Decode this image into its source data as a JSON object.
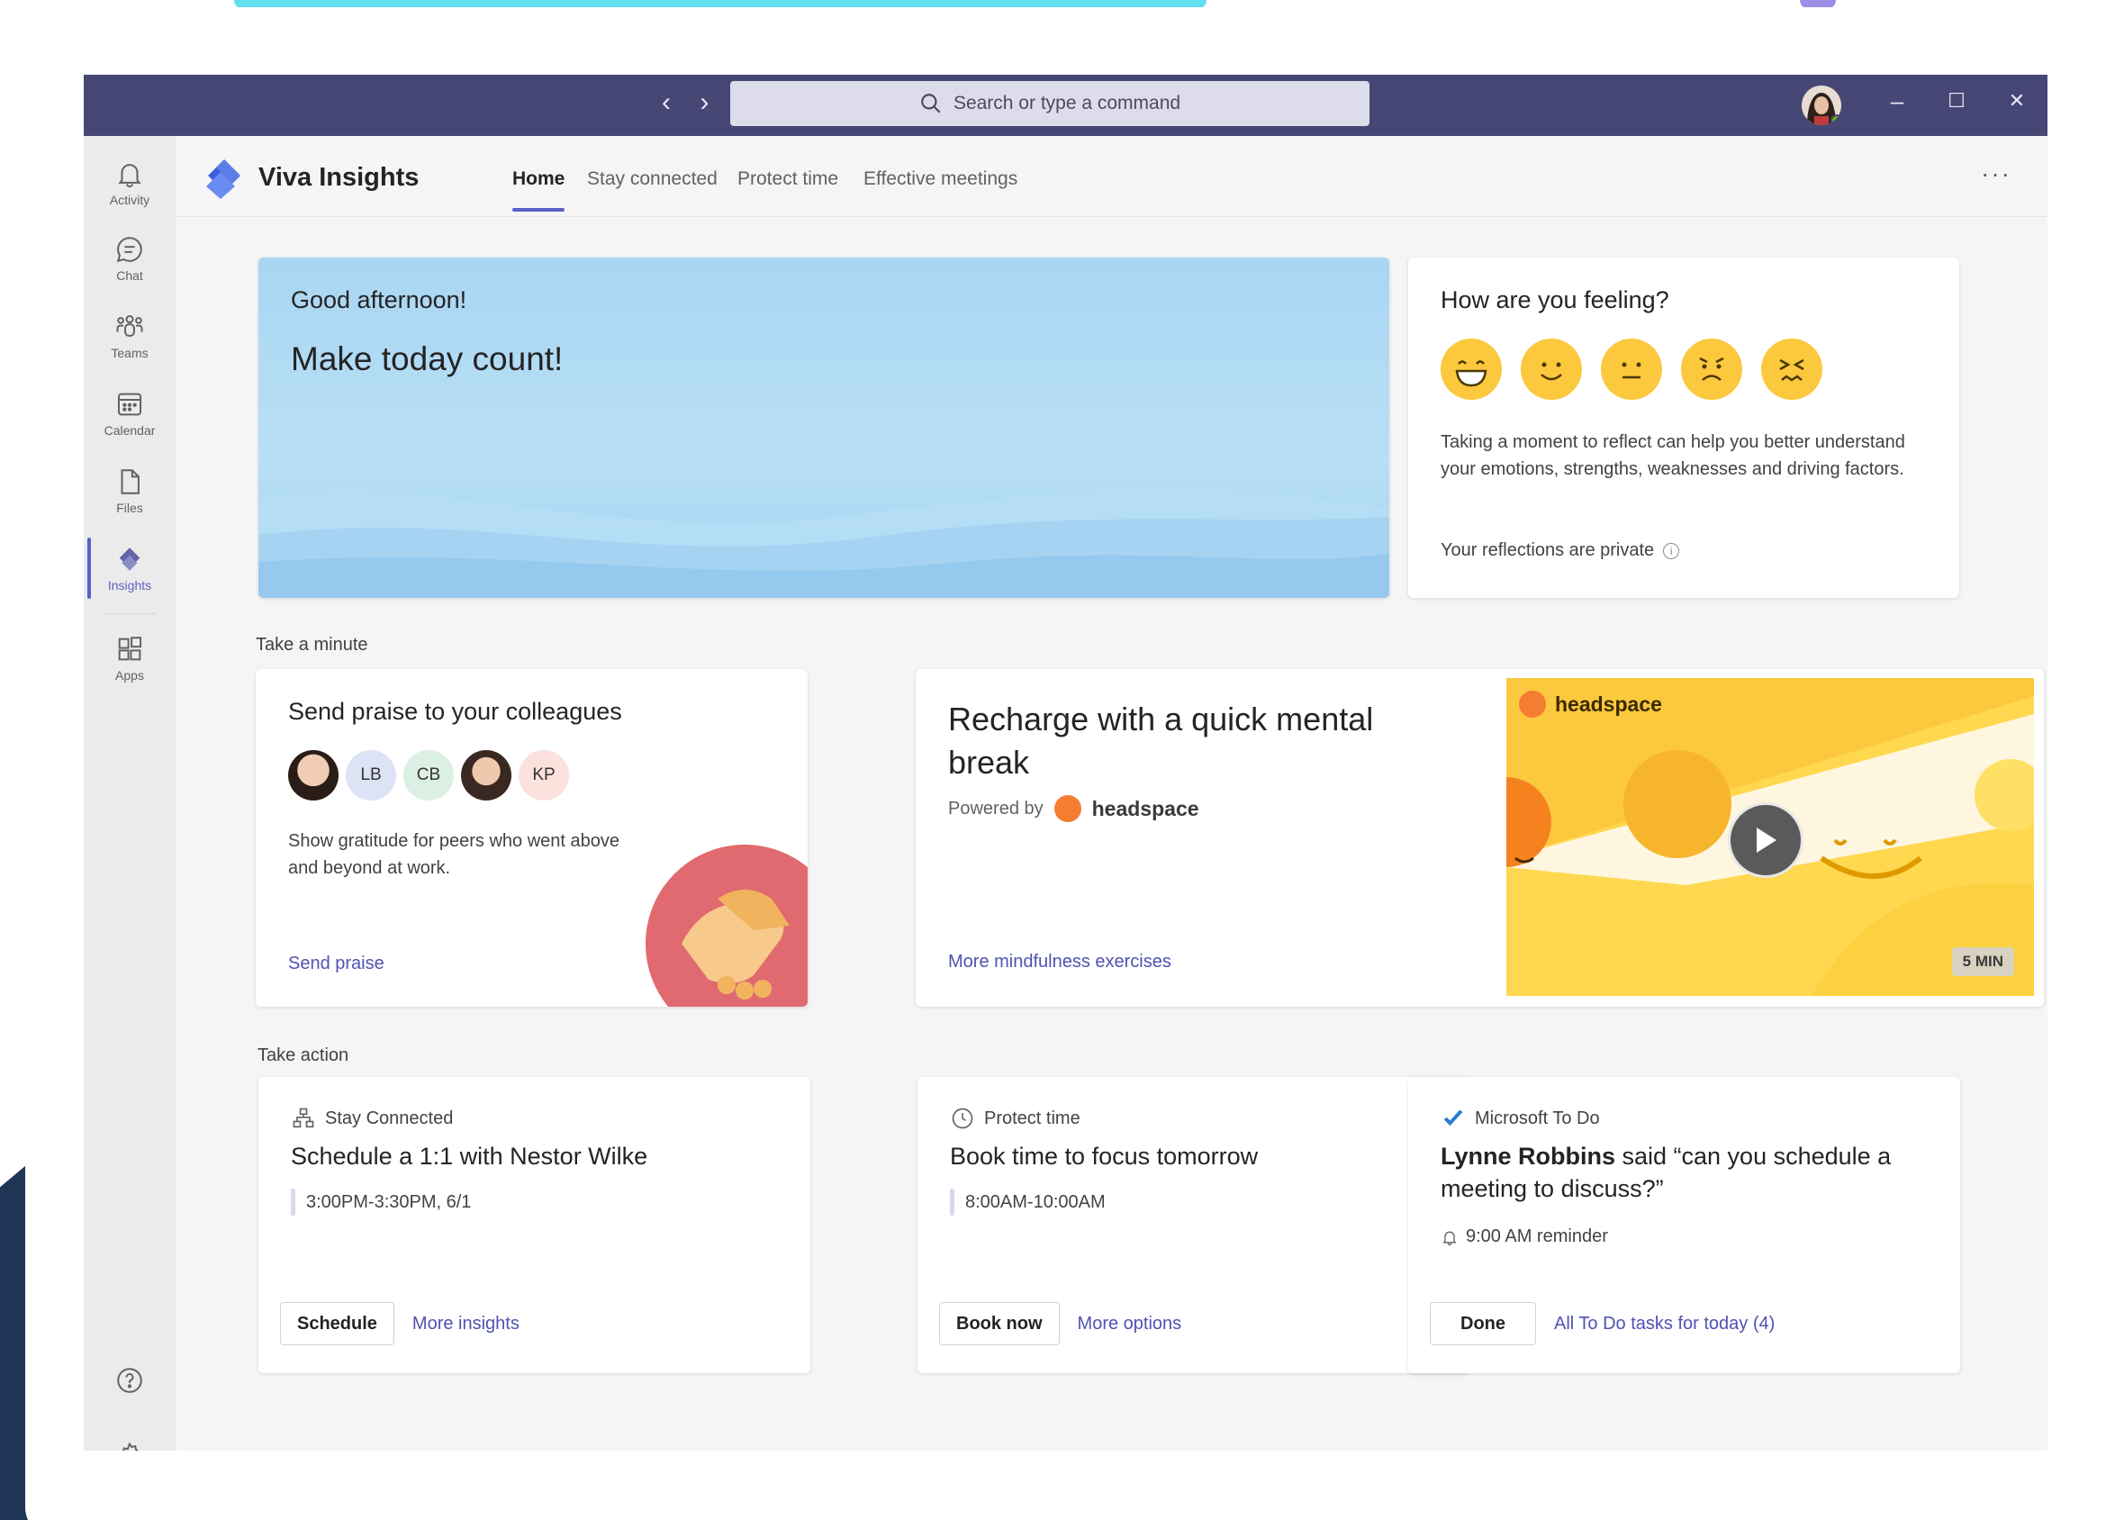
{
  "window": {
    "search_placeholder": "Search or type a command",
    "nav_arrows": "‹ ›",
    "controls": {
      "minimize": "–",
      "maximize": "☐",
      "close": "✕"
    }
  },
  "rail": {
    "items": [
      {
        "label": "Activity",
        "icon": "bell-icon"
      },
      {
        "label": "Chat",
        "icon": "chat-icon"
      },
      {
        "label": "Teams",
        "icon": "teams-icon"
      },
      {
        "label": "Calendar",
        "icon": "calendar-icon"
      },
      {
        "label": "Files",
        "icon": "file-icon"
      },
      {
        "label": "Insights",
        "icon": "insights-icon",
        "active": true
      },
      {
        "label": "Apps",
        "icon": "apps-icon"
      }
    ]
  },
  "app": {
    "title": "Viva Insights",
    "tabs": [
      "Home",
      "Stay connected",
      "Protect time",
      "Effective meetings"
    ],
    "active_tab": "Home",
    "more": "···"
  },
  "hero": {
    "greeting": "Good afternoon!",
    "tagline": "Make today count!"
  },
  "feeling": {
    "title": "How are you feeling?",
    "emojis": [
      "very-happy-emoji-icon",
      "happy-emoji-icon",
      "neutral-emoji-icon",
      "sad-emoji-icon",
      "upset-emoji-icon"
    ],
    "body": "Taking a moment to reflect can help you better understand your emotions, strengths, weaknesses and driving factors.",
    "private_note": "Your reflections are private",
    "info_glyph": "i"
  },
  "sections": {
    "take_a_minute": "Take a minute",
    "take_action": "Take action"
  },
  "praise": {
    "title": "Send praise to your colleagues",
    "avatars": [
      "",
      "LB",
      "CB",
      "",
      "KP"
    ],
    "body": "Show gratitude for peers who went above and beyond at work.",
    "link": "Send praise"
  },
  "recharge": {
    "title": "Recharge with a quick mental break",
    "powered_by": "Powered by",
    "brand": "headspace",
    "link": "More mindfulness exercises",
    "video": {
      "brand": "headspace",
      "duration": "5 MIN"
    }
  },
  "actions": [
    {
      "kicker": "Stay Connected",
      "title": "Schedule a 1:1 with Nestor Wilke",
      "meta": "3:00PM-3:30PM, 6/1",
      "button": "Schedule",
      "link": "More insights"
    },
    {
      "kicker": "Protect time",
      "title": "Book time to focus tomorrow",
      "meta": "8:00AM-10:00AM",
      "button": "Book now",
      "link": "More options"
    },
    {
      "kicker": "Microsoft To Do",
      "title_bold": "Lynne Robbins",
      "title_rest": " said “can you schedule a meeting to discuss?”",
      "reminder": "9:00 AM reminder",
      "button": "Done",
      "link": "All To Do tasks for today (4)"
    }
  ],
  "colors": {
    "titlebar": "#464775",
    "accent": "#5b5fc7",
    "link": "#4f52b2",
    "emoji": "#fcc83d"
  }
}
